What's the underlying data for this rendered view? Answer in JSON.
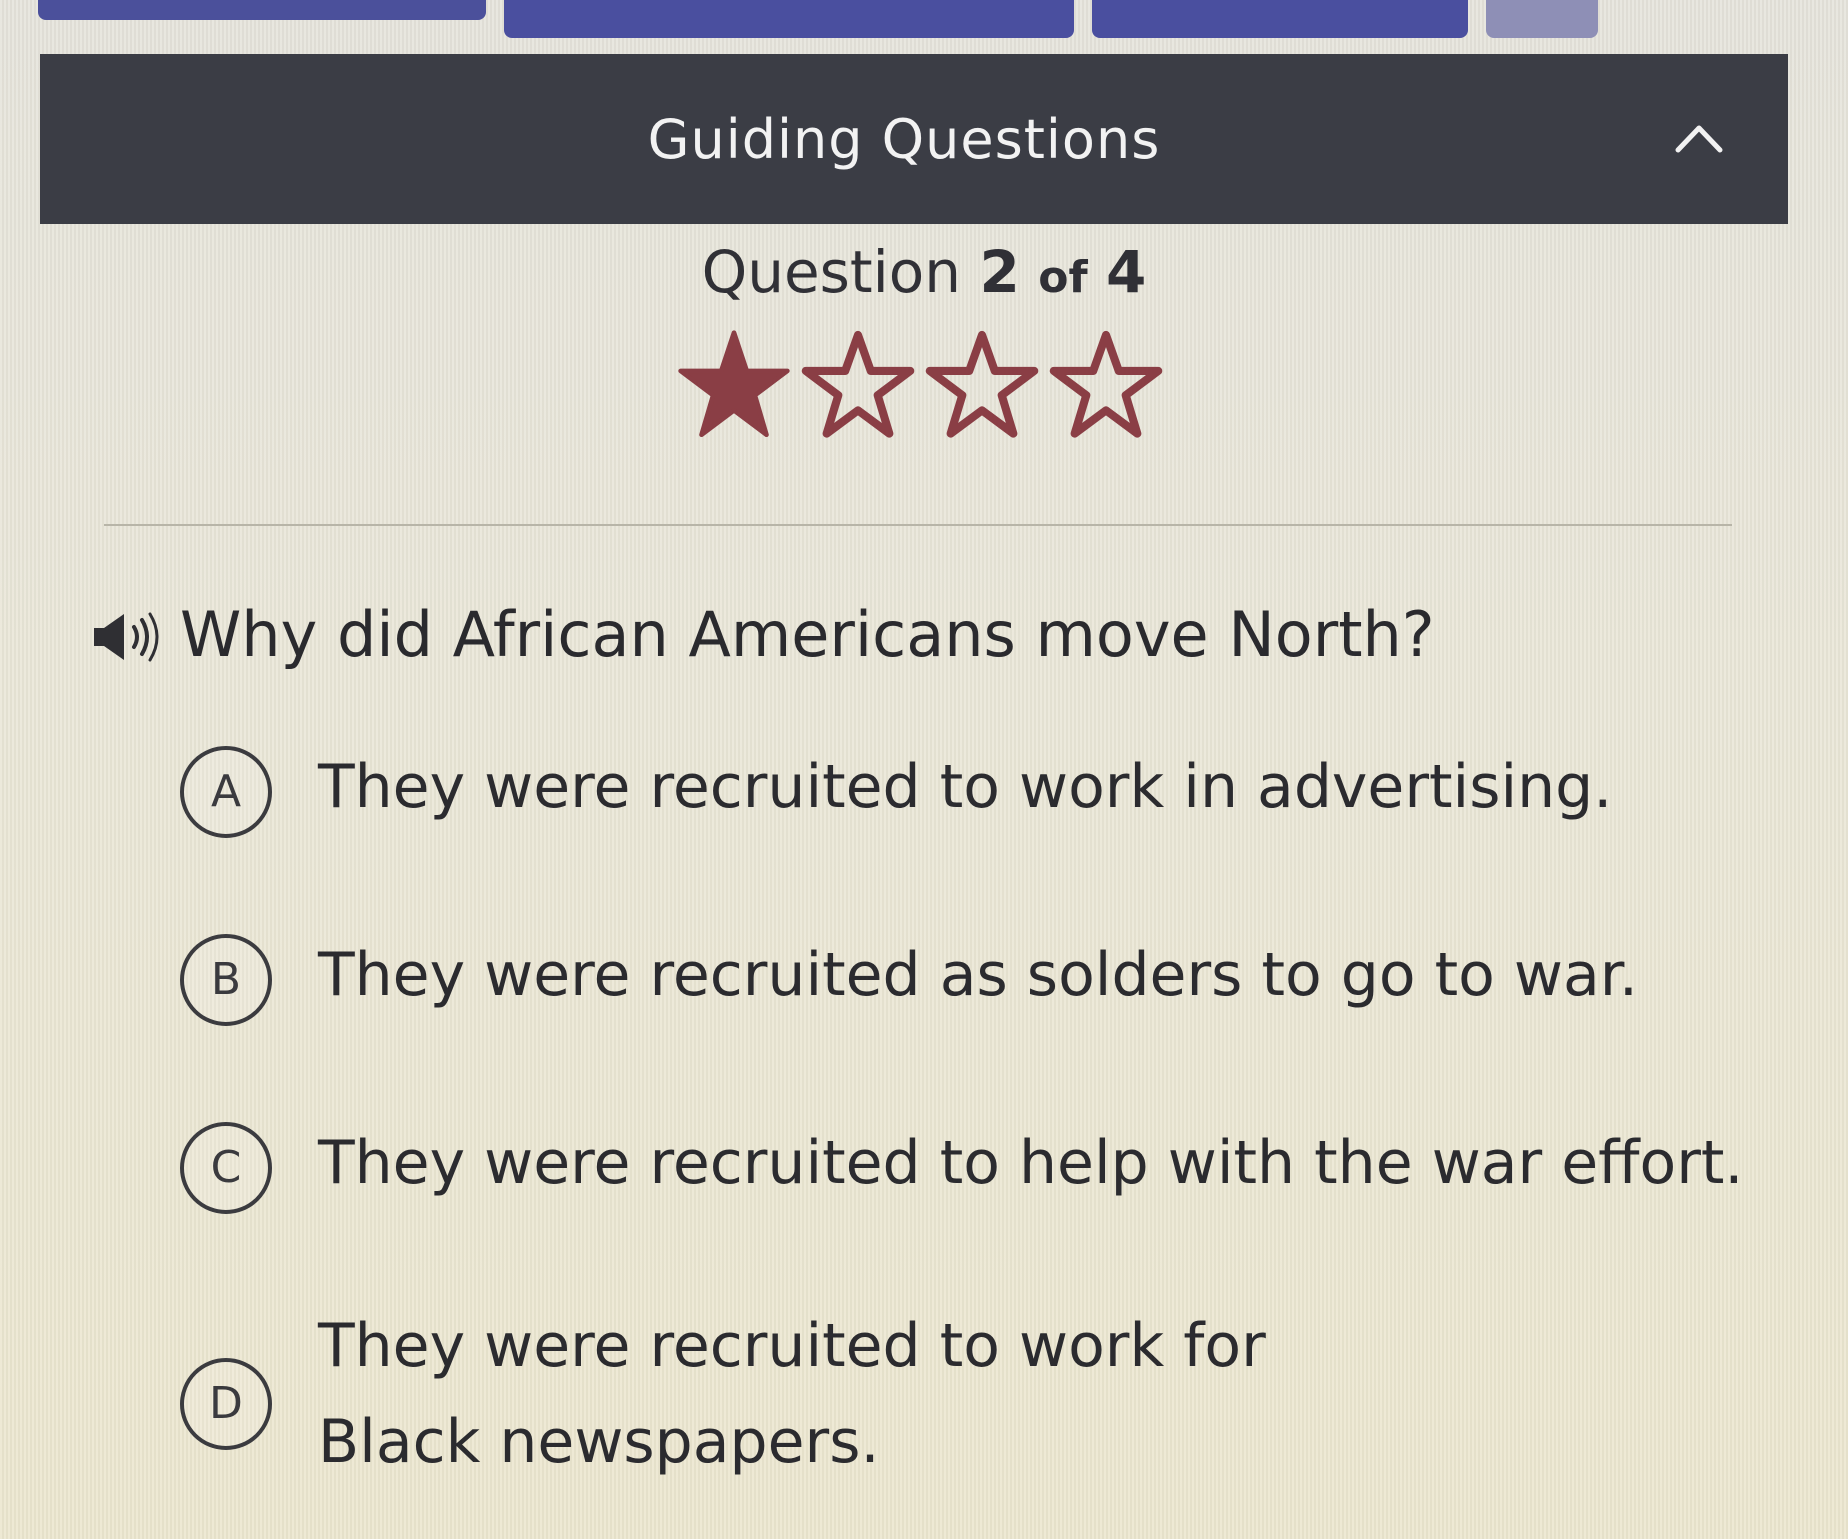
{
  "header": {
    "title": "Guiding Questions",
    "collapse_icon": "chevron-up-icon"
  },
  "progress": {
    "label_prefix": "Question",
    "current": "2",
    "of_label": "of",
    "total": "4"
  },
  "stars": {
    "filled": 1,
    "total": 4,
    "filled_color": "#8a3e45",
    "outline_color": "#8a3e45"
  },
  "question": {
    "audio_icon": "speaker-icon",
    "text": "Why did African Americans move North?"
  },
  "choices": [
    {
      "letter": "A",
      "text": "They were recruited to work in advertising."
    },
    {
      "letter": "B",
      "text": "They were recruited as solders to go to war."
    },
    {
      "letter": "C",
      "text": "They were recruited to help with the war effort."
    },
    {
      "letter": "D",
      "text": "They were recruited to work for Black newspapers."
    }
  ],
  "colors": {
    "header_bg": "#3b3d45",
    "tab_color": "#4a4f9f"
  }
}
